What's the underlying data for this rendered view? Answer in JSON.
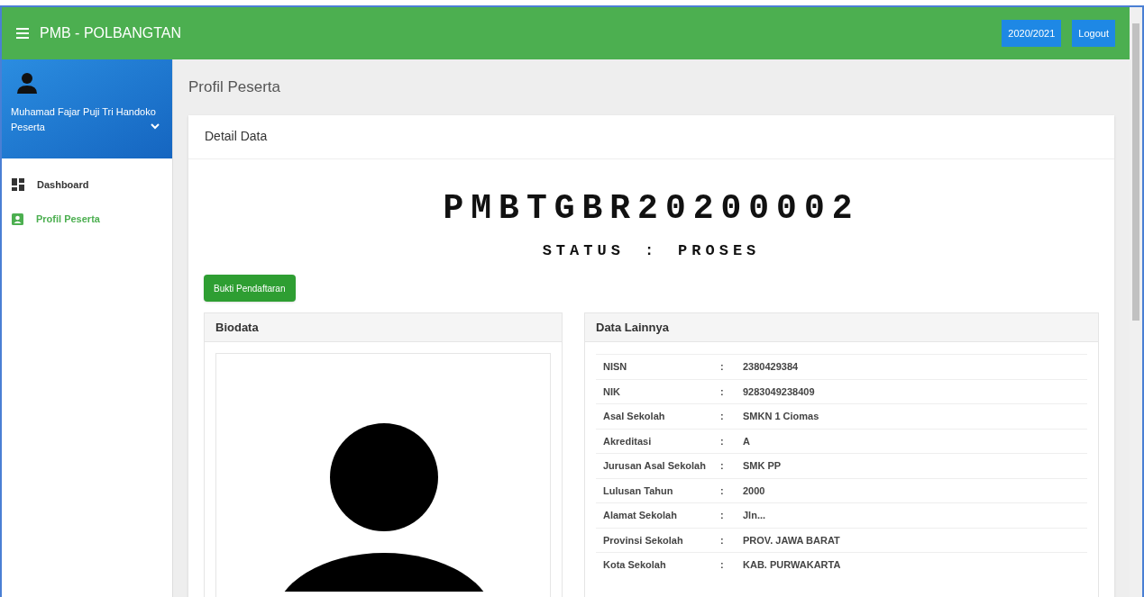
{
  "header": {
    "title": "PMB - POLBANGTAN",
    "buttons": [
      "2020/2021",
      "Logout"
    ]
  },
  "sidebar": {
    "user": {
      "name": "Muhamad Fajar Puji Tri Handoko",
      "role": "Peserta"
    },
    "items": [
      {
        "label": "Dashboard",
        "kind": "dashboard",
        "selected": false
      },
      {
        "label": "Profil Peserta",
        "kind": "profile",
        "selected": true
      }
    ]
  },
  "page_title": "Profil Peserta",
  "card": {
    "title": "Detail Data",
    "registration_id": "PMBTGBR20200002",
    "status_label": "STATUS",
    "status_separator": ":",
    "status_value": "PROSES",
    "button": "Bukti Pendaftaran",
    "biodata": {
      "title": "Biodata"
    },
    "data_lainnya": {
      "title": "Data Lainnya",
      "rows": [
        {
          "label": "NISN",
          "separator": ":",
          "value": "2380429384"
        },
        {
          "label": "NIK",
          "separator": ":",
          "value": "9283049238409"
        },
        {
          "label": "Asal Sekolah",
          "separator": ":",
          "value": "SMKN 1 Ciomas"
        },
        {
          "label": "Akreditasi",
          "separator": ":",
          "value": "A"
        },
        {
          "label": "Jurusan Asal Sekolah",
          "separator": ":",
          "value": "SMK PP"
        },
        {
          "label": "Lulusan Tahun",
          "separator": ":",
          "value": "2000"
        },
        {
          "label": "Alamat Sekolah",
          "separator": ":",
          "value": "Jln..."
        },
        {
          "label": "Provinsi Sekolah",
          "separator": ":",
          "value": "PROV. JAWA BARAT"
        },
        {
          "label": "Kota Sekolah",
          "separator": ":",
          "value": "KAB. PURWAKARTA"
        }
      ]
    }
  }
}
